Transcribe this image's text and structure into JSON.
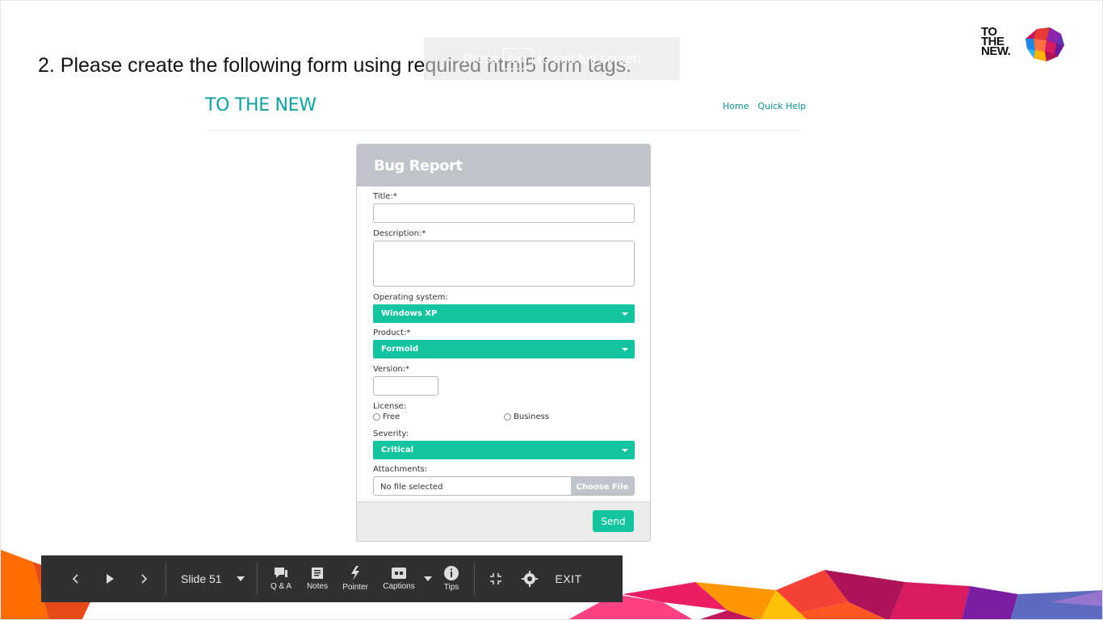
{
  "heading": "2. Please create the following form using required html5 form tags.",
  "esc_overlay": {
    "before": "Press",
    "key": "Esc",
    "after": "to exit full screen"
  },
  "logo": {
    "line1": "TO",
    "line2": "THE",
    "line3": "NEW."
  },
  "embedded": {
    "brand": "TO THE NEW",
    "nav": {
      "home": "Home",
      "quick_help": "Quick Help"
    },
    "form": {
      "title": "Bug Report",
      "title_label": "Title:*",
      "description_label": "Description:*",
      "os_label": "Operating system:",
      "os_value": "Windows XP",
      "product_label": "Product:*",
      "product_value": "Formoid",
      "version_label": "Version:*",
      "license_label": "License:",
      "license_free": "Free",
      "license_business": "Business",
      "severity_label": "Severity:",
      "severity_value": "Critical",
      "attachments_label": "Attachments:",
      "file_status": "No file selected",
      "choose_file": "Choose File",
      "send": "Send"
    }
  },
  "toolbar": {
    "prev_icon": "chevron-left-icon",
    "play_icon": "play-icon",
    "next_icon": "chevron-right-icon",
    "slide_label": "Slide 51",
    "qa": "Q & A",
    "notes": "Notes",
    "pointer": "Pointer",
    "captions": "Captions",
    "tips": "Tips",
    "exit": "EXIT"
  },
  "colors": {
    "accent_teal": "#12c4a0",
    "brand_teal": "#10a0a0",
    "toolbar_bg": "#303030"
  }
}
